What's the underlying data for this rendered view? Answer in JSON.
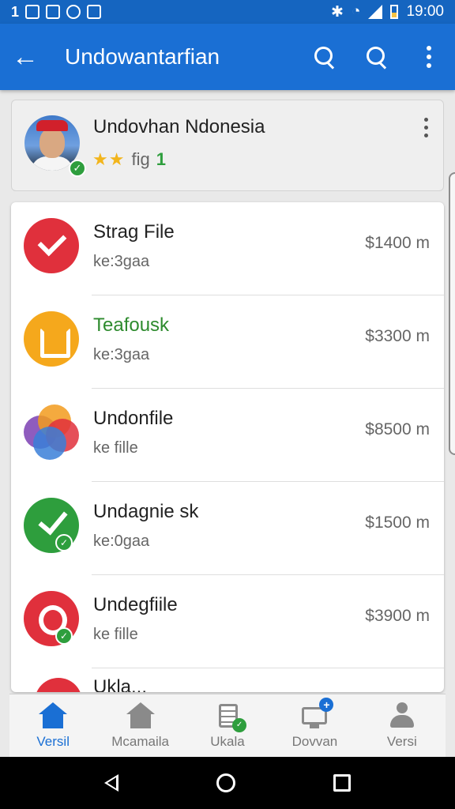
{
  "status_bar": {
    "left_text": "1",
    "time": "19:00"
  },
  "app_bar": {
    "title": "Undowantarfian"
  },
  "profile": {
    "name": "Undovhan Ndonesia",
    "stars": "★★",
    "meta_text": "fig",
    "meta_count": "1"
  },
  "list": [
    {
      "title": "Strag File",
      "subtitle": "ke:3gaa",
      "amount": "$1400 m",
      "icon": "check-icon",
      "color": "#e0303c"
    },
    {
      "title": "Teafousk",
      "subtitle": "ke:3gaa",
      "amount": "$3300 m",
      "icon": "square-icon",
      "color": "#f5a81c",
      "title_color": "#2e8b2e"
    },
    {
      "title": "Undonfile",
      "subtitle": "ke fille",
      "amount": "$8500 m",
      "icon": "blend-icon"
    },
    {
      "title": "Undagnie sk",
      "subtitle": "ke:0gaa",
      "amount": "$1500 m",
      "icon": "check-icon",
      "color": "#2e9e3d"
    },
    {
      "title": "Undegfiile",
      "subtitle": "ke fille",
      "amount": "$3900 m",
      "icon": "q-icon",
      "color": "#e0303c"
    }
  ],
  "partial_row_title": "Ukla...",
  "bottom_nav": [
    {
      "label": "Versil",
      "icon": "home-icon",
      "active": true
    },
    {
      "label": "Mcamaila",
      "icon": "home-icon",
      "active": false
    },
    {
      "label": "Ukala",
      "icon": "document-icon",
      "active": false
    },
    {
      "label": "Dovvan",
      "icon": "monitor-icon",
      "active": false
    },
    {
      "label": "Versi",
      "icon": "person-icon",
      "active": false
    }
  ],
  "colors": {
    "primary": "#1a6fd4",
    "status_bar": "#1565c0",
    "success": "#2e9e3d",
    "danger": "#e0303c",
    "warning": "#f5a81c"
  }
}
